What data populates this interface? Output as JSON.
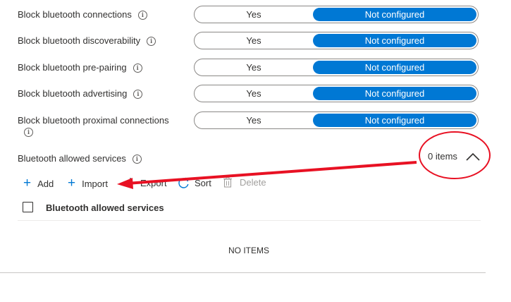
{
  "settings": [
    {
      "label": "Block bluetooth connections",
      "option_yes": "Yes",
      "option_selected": "Not configured"
    },
    {
      "label": "Block bluetooth discoverability",
      "option_yes": "Yes",
      "option_selected": "Not configured"
    },
    {
      "label": "Block bluetooth pre-pairing",
      "option_yes": "Yes",
      "option_selected": "Not configured"
    },
    {
      "label": "Block bluetooth advertising",
      "option_yes": "Yes",
      "option_selected": "Not configured"
    },
    {
      "label": "Block bluetooth proximal connections",
      "option_yes": "Yes",
      "option_selected": "Not configured"
    }
  ],
  "info_glyph": "i",
  "allowed_services": {
    "label": "Bluetooth allowed services",
    "count_text": "0 items"
  },
  "toolbar": {
    "add_label": "Add",
    "import_label": "Import",
    "export_label": "Export",
    "sort_label": "Sort",
    "delete_label": "Delete"
  },
  "table": {
    "column_header": "Bluetooth allowed services",
    "empty_text": "NO ITEMS"
  },
  "colors": {
    "accent": "#0078d4",
    "annotation": "#e81123"
  }
}
